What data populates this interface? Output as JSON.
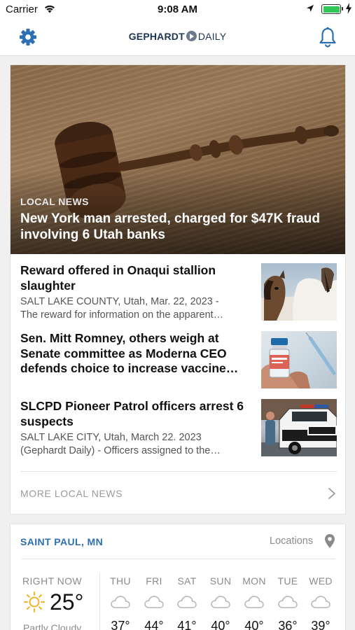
{
  "status_bar": {
    "carrier": "Carrier",
    "time": "9:08 AM",
    "battery_color": "#33c759"
  },
  "nav": {
    "logo_part1": "GEPHARDT",
    "logo_part2": "DAILY",
    "left_icon": "gear-icon",
    "right_icon": "bell-icon",
    "accent": "#2e6fb4"
  },
  "hero": {
    "kicker": "LOCAL NEWS",
    "title": "New York man arrested, charged for $47K fraud involving 6 Utah banks"
  },
  "articles": [
    {
      "title": "Reward offered in Onaqui stallion slaughter",
      "meta_line1": "SALT LAKE COUNTY, Utah, Mar. 22, 2023 -",
      "meta_line2": "The reward for information on the apparent…"
    },
    {
      "title": "Sen. Mitt Romney, others weigh at Senate committee as Moderna CEO defends choice to increase vaccine…"
    },
    {
      "title": "SLCPD Pioneer Patrol officers arrest 6 suspects",
      "meta_line1": "SALT LAKE CITY, Utah, March 22. 2023",
      "meta_line2": "(Gephardt Daily) - Officers assigned to the…"
    }
  ],
  "more_news": "MORE LOCAL NEWS",
  "weather": {
    "city": "SAINT PAUL, MN",
    "locations_label": "Locations",
    "now_label": "RIGHT NOW",
    "now_temp": "25°",
    "now_condition": "Partly Cloudy",
    "forecast": [
      {
        "day": "THU",
        "temp": "37°"
      },
      {
        "day": "FRI",
        "temp": "44°"
      },
      {
        "day": "SAT",
        "temp": "41°"
      },
      {
        "day": "SUN",
        "temp": "40°"
      },
      {
        "day": "MON",
        "temp": "40°"
      },
      {
        "day": "TUE",
        "temp": "36°"
      },
      {
        "day": "WED",
        "temp": "39°"
      }
    ]
  }
}
